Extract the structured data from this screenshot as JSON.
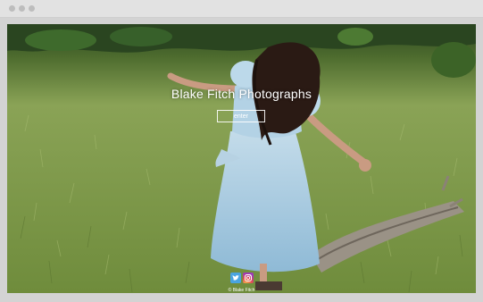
{
  "site": {
    "title": "Blake Fitch Photographs",
    "enter_label": "enter",
    "copyright": "© Blake Fitch"
  },
  "social": [
    {
      "name": "twitter-icon",
      "color": "#4aa4e0"
    },
    {
      "name": "instagram-icon",
      "color": "#c13584"
    }
  ],
  "colors": {
    "chrome": "#e2e2e2",
    "grass": "#7f9a4a",
    "dress": "#a9cde3",
    "hair": "#2a1a14"
  }
}
